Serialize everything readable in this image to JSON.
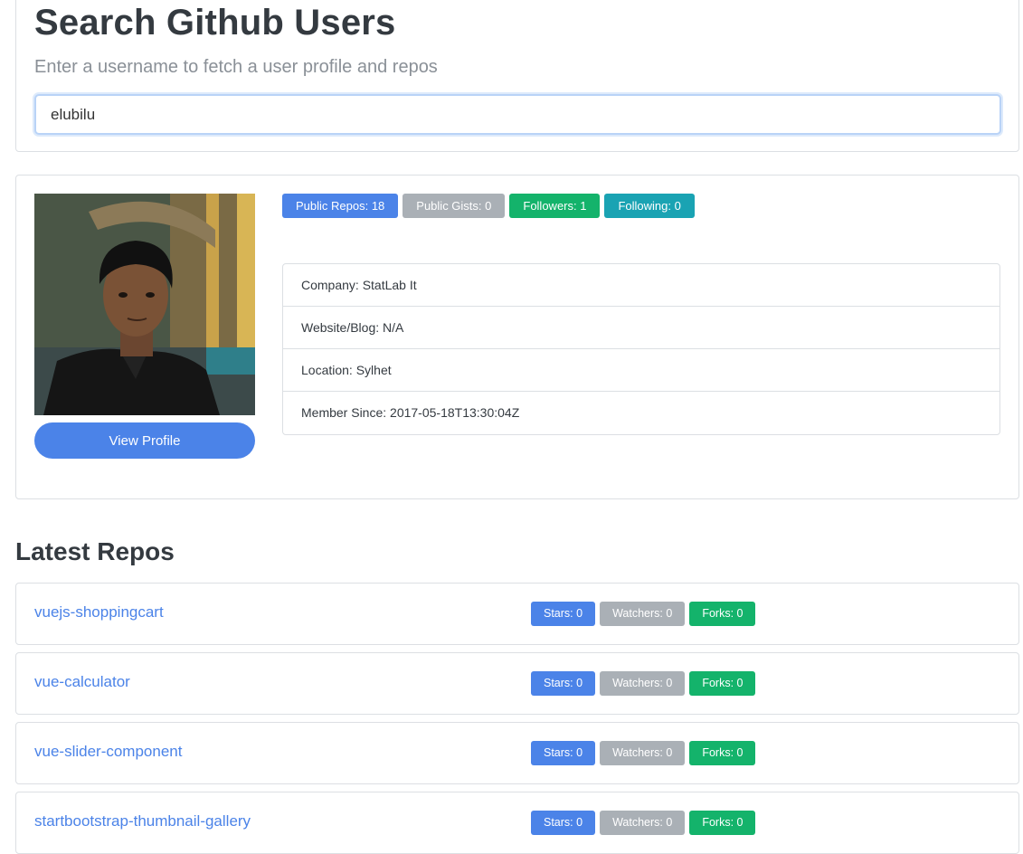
{
  "search": {
    "title": "Search Github Users",
    "subtitle": "Enter a username to fetch a user profile and repos",
    "value": "elubilu"
  },
  "profile": {
    "avatar_alt": "profile photo",
    "view_profile_label": "View Profile",
    "badges": {
      "public_repos": "Public Repos: 18",
      "public_gists": "Public Gists: 0",
      "followers": "Followers: 1",
      "following": "Following: 0"
    },
    "info": {
      "company": "Company: StatLab It",
      "website": "Website/Blog: N/A",
      "location": "Location: Sylhet",
      "member_since": "Member Since: 2017-05-18T13:30:04Z"
    }
  },
  "repos": {
    "heading": "Latest Repos",
    "items": [
      {
        "name": "vuejs-shoppingcart",
        "stars": "Stars: 0",
        "watchers": "Watchers: 0",
        "forks": "Forks: 0"
      },
      {
        "name": "vue-calculator",
        "stars": "Stars: 0",
        "watchers": "Watchers: 0",
        "forks": "Forks: 0"
      },
      {
        "name": "vue-slider-component",
        "stars": "Stars: 0",
        "watchers": "Watchers: 0",
        "forks": "Forks: 0"
      },
      {
        "name": "startbootstrap-thumbnail-gallery",
        "stars": "Stars: 0",
        "watchers": "Watchers: 0",
        "forks": "Forks: 0"
      }
    ]
  },
  "colors": {
    "primary": "#4b83e8",
    "secondary": "#aab0b6",
    "success": "#14b36b",
    "info": "#1aa3b3"
  }
}
